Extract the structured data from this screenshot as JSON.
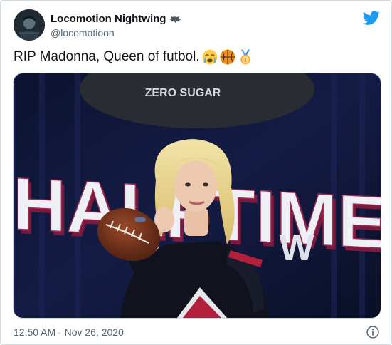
{
  "author": {
    "display_name": "Locomotion Nightwing",
    "handle": "@locomotioon",
    "badge_icon": "bat-icon"
  },
  "tweet": {
    "text": "RIP Madonna, Queen of futbol.",
    "emojis": [
      "crying-face-emoji",
      "basketball-emoji",
      "first-place-medal-emoji"
    ],
    "timestamp": "12:50 AM · Nov 26, 2020"
  },
  "media": {
    "sign_text": "HALFTIME",
    "sign_sub": "ZERO SUGAR",
    "sign_letters_bottom": "W"
  },
  "icons": {
    "platform": "twitter-bird-icon",
    "info": "info-icon"
  },
  "colors": {
    "twitter_blue": "#1d9bf0",
    "text_primary": "#0f1419",
    "text_secondary": "#536471"
  }
}
